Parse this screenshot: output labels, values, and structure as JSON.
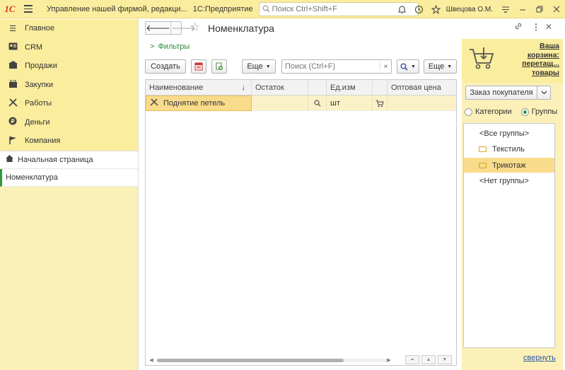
{
  "titlebar": {
    "logo": "1С",
    "app_title": "Управление нашей фирмой, редакци...",
    "app_name": "1С:Предприятие",
    "search_placeholder": "Поиск Ctrl+Shift+F",
    "user": "Швецова О.М.",
    "icons": [
      "bell-icon",
      "history-icon",
      "star-icon",
      "menu-icon",
      "minimize-icon",
      "restore-icon",
      "close-icon"
    ]
  },
  "sidebar": {
    "sections": [
      {
        "label": "Главное",
        "icon": "hamburger-icon"
      },
      {
        "label": "CRM",
        "icon": "crm-icon"
      },
      {
        "label": "Продажи",
        "icon": "sales-icon"
      },
      {
        "label": "Закупки",
        "icon": "purchases-icon"
      },
      {
        "label": "Работы",
        "icon": "tools-icon"
      },
      {
        "label": "Деньги",
        "icon": "money-icon"
      },
      {
        "label": "Компания",
        "icon": "flag-icon"
      }
    ],
    "open_items": [
      {
        "label": "Начальная страница",
        "icon": "home-icon"
      },
      {
        "label": "Номенклатура"
      }
    ]
  },
  "main": {
    "title": "Номенклатура",
    "filters_label": "Фильтры",
    "toolbar": {
      "create_label": "Создать",
      "more_label": "Еще",
      "search_placeholder": "Поиск (Ctrl+F)",
      "clear_label": "×",
      "more2_label": "Еще"
    },
    "table": {
      "columns": [
        "Наименование",
        "Остаток",
        "",
        "Ед.изм",
        "",
        "Оптовая цена"
      ],
      "rows": [
        {
          "name": "Поднятие петель",
          "stock": "",
          "unit": "шт",
          "price": ""
        }
      ]
    }
  },
  "right_panel": {
    "cart_text": "Ваша корзина: перетащ... товары",
    "order_button": "Заказ покупателя",
    "radio_categories": "Категории",
    "radio_groups": "Группы",
    "selected_radio": "Группы",
    "groups": [
      {
        "label": "<Все группы>",
        "folder": false,
        "selected": false
      },
      {
        "label": "Текстиль",
        "folder": true,
        "selected": false
      },
      {
        "label": "Трикотаж",
        "folder": true,
        "selected": true
      },
      {
        "label": "<Нет группы>",
        "folder": false,
        "selected": false
      }
    ],
    "collapse_label": "свернуть"
  }
}
